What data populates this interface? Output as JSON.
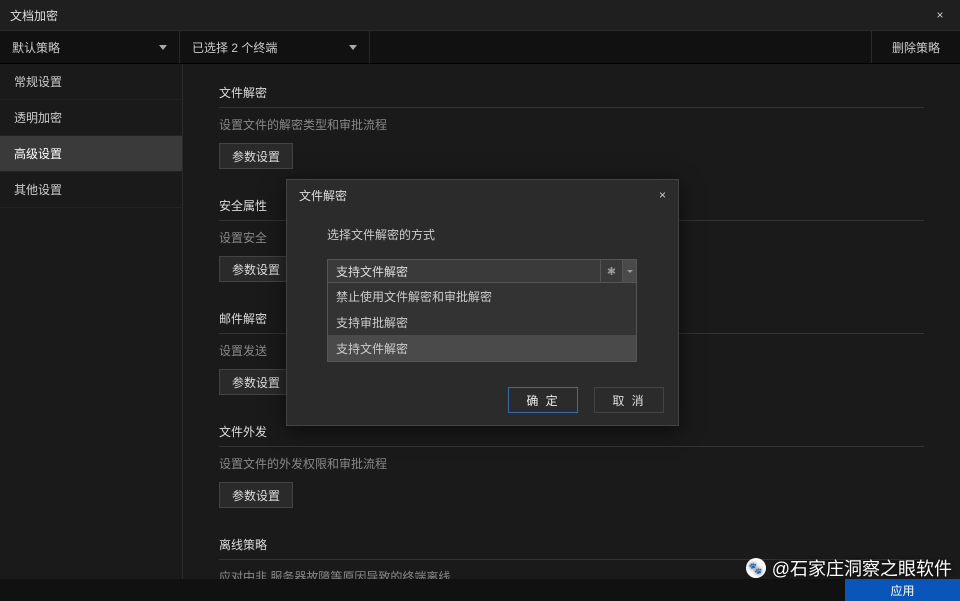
{
  "window": {
    "title": "文档加密",
    "close": "×"
  },
  "toolbar": {
    "policy": "默认策略",
    "endpoints": "已选择 2 个终端",
    "delete": "删除策略"
  },
  "sidebar": {
    "items": [
      {
        "label": "常规设置"
      },
      {
        "label": "透明加密"
      },
      {
        "label": "高级设置"
      },
      {
        "label": "其他设置"
      }
    ]
  },
  "sections": [
    {
      "title": "文件解密",
      "desc": "设置文件的解密类型和审批流程",
      "btn": "参数设置"
    },
    {
      "title": "安全属性",
      "desc": "设置安全",
      "btn": "参数设置"
    },
    {
      "title": "邮件解密",
      "desc": "设置发送",
      "btn": "参数设置"
    },
    {
      "title": "文件外发",
      "desc": "设置文件的外发权限和审批流程",
      "btn": "参数设置"
    },
    {
      "title": "离线策略",
      "desc": "应对中非  服务器故障等原因导致的终端离线"
    }
  ],
  "modal": {
    "title": "文件解密",
    "label": "选择文件解密的方式",
    "selected": "支持文件解密",
    "options": [
      "禁止使用文件解密和审批解密",
      "支持审批解密",
      "支持文件解密"
    ],
    "ok": "确 定",
    "cancel": "取 消",
    "close": "×"
  },
  "footer": {
    "apply": "应用"
  },
  "watermark": {
    "text": "@石家庄洞察之眼软件"
  }
}
